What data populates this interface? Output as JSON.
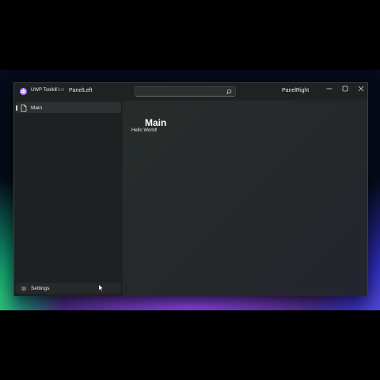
{
  "app": {
    "name": "UWP Toolkit",
    "subtitle": "Test",
    "panel_left_label": "PanelLeft",
    "panel_right_label": "PanelRight"
  },
  "search": {
    "value": "",
    "icon": "search-icon"
  },
  "caption_buttons": {
    "minimize_icon": "minimize-icon",
    "maximize_icon": "maximize-icon",
    "close_icon": "close-icon"
  },
  "sidebar": {
    "items": [
      {
        "label": "Main",
        "icon": "page-icon",
        "selected": true
      }
    ],
    "footer": {
      "label": "Settings",
      "icon": "gear-icon"
    }
  },
  "main": {
    "title": "Main",
    "body": "Hello World!"
  },
  "colors": {
    "window_bg": "#202424",
    "sidebar_bg": "#1d2121",
    "selected_item": "#2c3131",
    "text": "#e8e8e8"
  }
}
